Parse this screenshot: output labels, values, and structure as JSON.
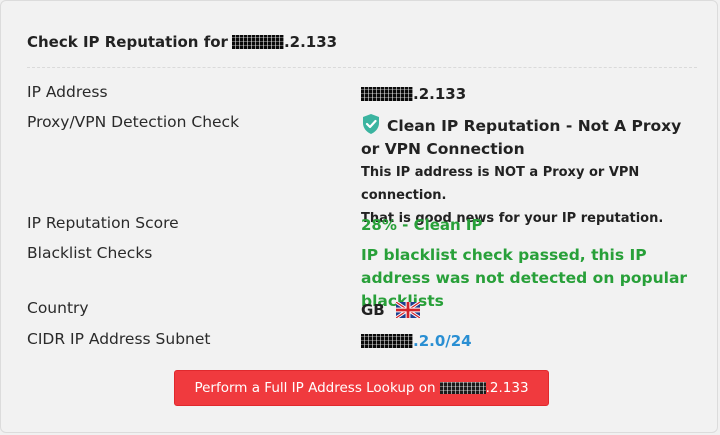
{
  "header": {
    "title_prefix": "Check IP Reputation for",
    "ip_suffix": ".2.133"
  },
  "rows": [
    {
      "label": "IP Address",
      "value_suffix": ".2.133"
    },
    {
      "label": "Proxy/VPN Detection Check",
      "status_icon": "shield-check-icon",
      "status_title": "Clean IP Reputation - Not A Proxy or VPN Connection",
      "detail_line1": "This IP address is NOT a Proxy or VPN connection.",
      "detail_line2": "That is good news for your IP reputation."
    },
    {
      "label": "IP Reputation Score",
      "value": "28% - Clean IP"
    },
    {
      "label": "Blacklist Checks",
      "value": "IP blacklist check passed, this IP address was not detected on popular blacklists"
    },
    {
      "label": "Country",
      "value": "GB",
      "flag_icon": "uk-flag-icon"
    },
    {
      "label": "CIDR IP Address Subnet",
      "value_suffix": ".2.0/24"
    }
  ],
  "action": {
    "button_prefix": "Perform a Full IP Address Lookup on",
    "ip_suffix": ".2.133"
  },
  "colors": {
    "accent_green": "#28a039",
    "link_blue": "#2a8fd3",
    "button_red": "#f03a3e"
  }
}
